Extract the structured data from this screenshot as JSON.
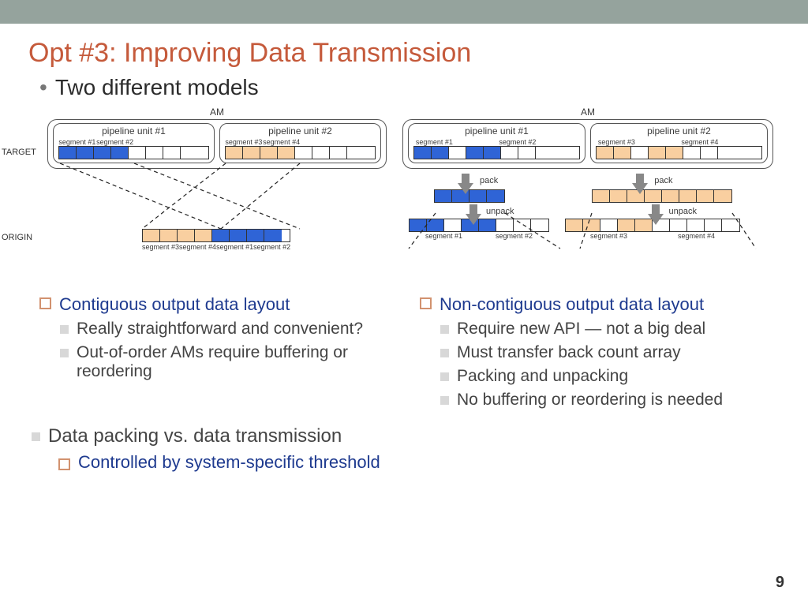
{
  "title": "Opt #3: Improving Data Transmission",
  "subtitle": "Two different models",
  "left_diagram": {
    "am": "AM",
    "target": "TARGET",
    "origin": "ORIGIN",
    "pipe1": "pipeline unit #1",
    "pipe2": "pipeline unit #2",
    "seg1": "segment #1",
    "seg2": "segment #2",
    "seg3": "segment #3",
    "seg4": "segment #4",
    "seg3b": "segment #3",
    "seg4b": "segment #4",
    "seg1b": "segment #1",
    "seg2b": "segment #2"
  },
  "right_diagram": {
    "am": "AM",
    "pipe1": "pipeline unit #1",
    "pipe2": "pipeline unit #2",
    "seg1": "segment #1",
    "seg2": "segment #2",
    "seg3": "segment #3",
    "seg4": "segment #4",
    "pack": "pack",
    "unpack": "unpack",
    "bseg1": "segment #1",
    "bseg2": "segment #2",
    "bseg3": "segment #3",
    "bseg4": "segment #4"
  },
  "left_col": {
    "heading": "Contiguous output data layout",
    "b1": "Really straightforward and convenient?",
    "b2": "Out-of-order AMs require buffering or reordering"
  },
  "right_col": {
    "heading": "Non-contiguous output data layout",
    "b1": "Require new API — not a big deal",
    "b2": "Must transfer back count array",
    "b3": "Packing and unpacking",
    "b4": "No buffering or reordering is needed"
  },
  "footer": {
    "l1": "Data packing vs. data transmission",
    "l2": "Controlled by system-specific threshold"
  },
  "page": "9"
}
